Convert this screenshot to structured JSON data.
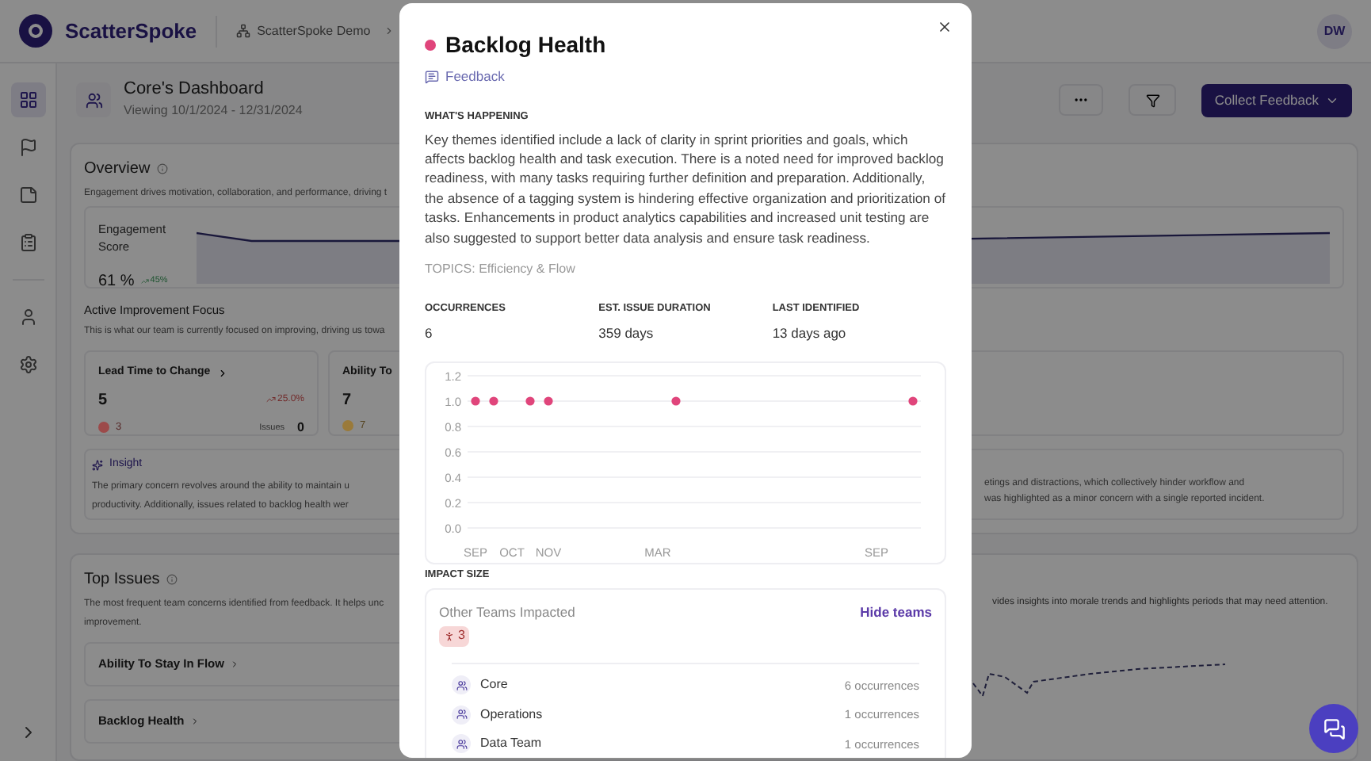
{
  "app": {
    "brand": "ScatterSpoke",
    "breadcrumb": "ScatterSpoke Demo",
    "avatar": "DW"
  },
  "sidebar": {
    "items": [
      {
        "kind": "grid",
        "selected": true
      },
      {
        "kind": "flag",
        "selected": false
      },
      {
        "kind": "note",
        "selected": false
      },
      {
        "kind": "clipboard",
        "selected": false
      },
      {
        "kind": "user",
        "selected": false
      },
      {
        "kind": "settings",
        "selected": false
      }
    ]
  },
  "dashboard": {
    "title": "Core's Dashboard",
    "subtitle": "Viewing 10/1/2024 - 12/31/2024",
    "primary_button": "Collect Feedback"
  },
  "overview": {
    "title": "Overview",
    "description": "Engagement drives motivation, collaboration, and performance, driving t",
    "engagement": {
      "label": "Engagement Score",
      "value": "61 %",
      "change": "45%"
    },
    "focus": {
      "title": "Active Improvement Focus",
      "description": "This is what our team is currently focused on improving, driving us towa",
      "cards": [
        {
          "title": "Lead Time to Change",
          "value": "5",
          "change": "25.0%",
          "count": "3",
          "issues_label": "Issues",
          "issues": "0",
          "color": "#9c4a4a"
        },
        {
          "title": "Ability To",
          "value": "7",
          "count": "7",
          "color": "#9a7a3a"
        }
      ]
    },
    "insight": {
      "label": "Insight",
      "left_lines": [
        "The primary concern revolves around the ability to maintain u",
        "productivity. Additionally, issues related to backlog health wer"
      ],
      "right_lines": [
        "etings and distractions, which collectively hinder workflow and",
        "was highlighted as a minor concern with a single reported incident."
      ]
    }
  },
  "top_issues": {
    "title": "Top Issues",
    "description_left": [
      "The most frequent team concerns identified from feedback. It helps unc",
      "improvement."
    ],
    "description_right": "vides insights into morale trends and highlights periods that may need attention.",
    "items": [
      "Ability To Stay In Flow",
      "Backlog Health"
    ]
  },
  "modal": {
    "title": "Backlog Health",
    "link": "Feedback",
    "section_label": "WHAT'S HAPPENING",
    "summary": "Key themes identified include a lack of clarity in sprint priorities and goals, which affects backlog health and task execution. There is a noted need for improved backlog readiness, with many tasks requiring further definition and preparation. Additionally, the absence of a tagging system is hindering effective organization and prioritization of tasks. Enhancements in product analytics capabilities and increased unit testing are also suggested to support better data analysis and ensure task readiness.",
    "topics": "TOPICS: Efficiency & Flow",
    "stats": [
      {
        "label": "OCCURRENCES",
        "value": "6"
      },
      {
        "label": "EST. ISSUE DURATION",
        "value": "359 days"
      },
      {
        "label": "LAST IDENTIFIED",
        "value": "13 days ago"
      }
    ],
    "chart_data": {
      "type": "scatter",
      "categories": [
        "SEP",
        null,
        "OCT",
        null,
        "NOV",
        null,
        null,
        null,
        null,
        null,
        "MAR",
        null,
        null,
        null,
        null,
        null,
        null,
        null,
        null,
        null,
        null,
        null,
        "SEP",
        null,
        null
      ],
      "series": [
        {
          "color": "#e0457b",
          "values": [
            1,
            1,
            null,
            1,
            1,
            null,
            null,
            null,
            null,
            null,
            null,
            1,
            null,
            null,
            null,
            null,
            null,
            null,
            null,
            null,
            null,
            null,
            null,
            null,
            1
          ]
        }
      ],
      "ylim": [
        0,
        1.2
      ],
      "grid": true,
      "yticks": [
        {
          "value": 0,
          "label": "0.0"
        },
        {
          "value": 0.2,
          "label": "0.2"
        },
        {
          "value": 0.4,
          "label": "0.4"
        },
        {
          "value": 0.6,
          "label": "0.6"
        },
        {
          "value": 0.8,
          "label": "0.8"
        },
        {
          "value": 1,
          "label": "1.0"
        },
        {
          "value": 1.2,
          "label": "1.2"
        }
      ]
    },
    "impact": {
      "label": "IMPACT SIZE",
      "title": "Other Teams Impacted",
      "toggle": "Hide teams",
      "count": "3",
      "teams": [
        {
          "name": "Core",
          "occurrences": "6 occurrences"
        },
        {
          "name": "Operations",
          "occurrences": "1 occurrences"
        },
        {
          "name": "Data Team",
          "occurrences": "1 occurrences"
        }
      ]
    }
  }
}
